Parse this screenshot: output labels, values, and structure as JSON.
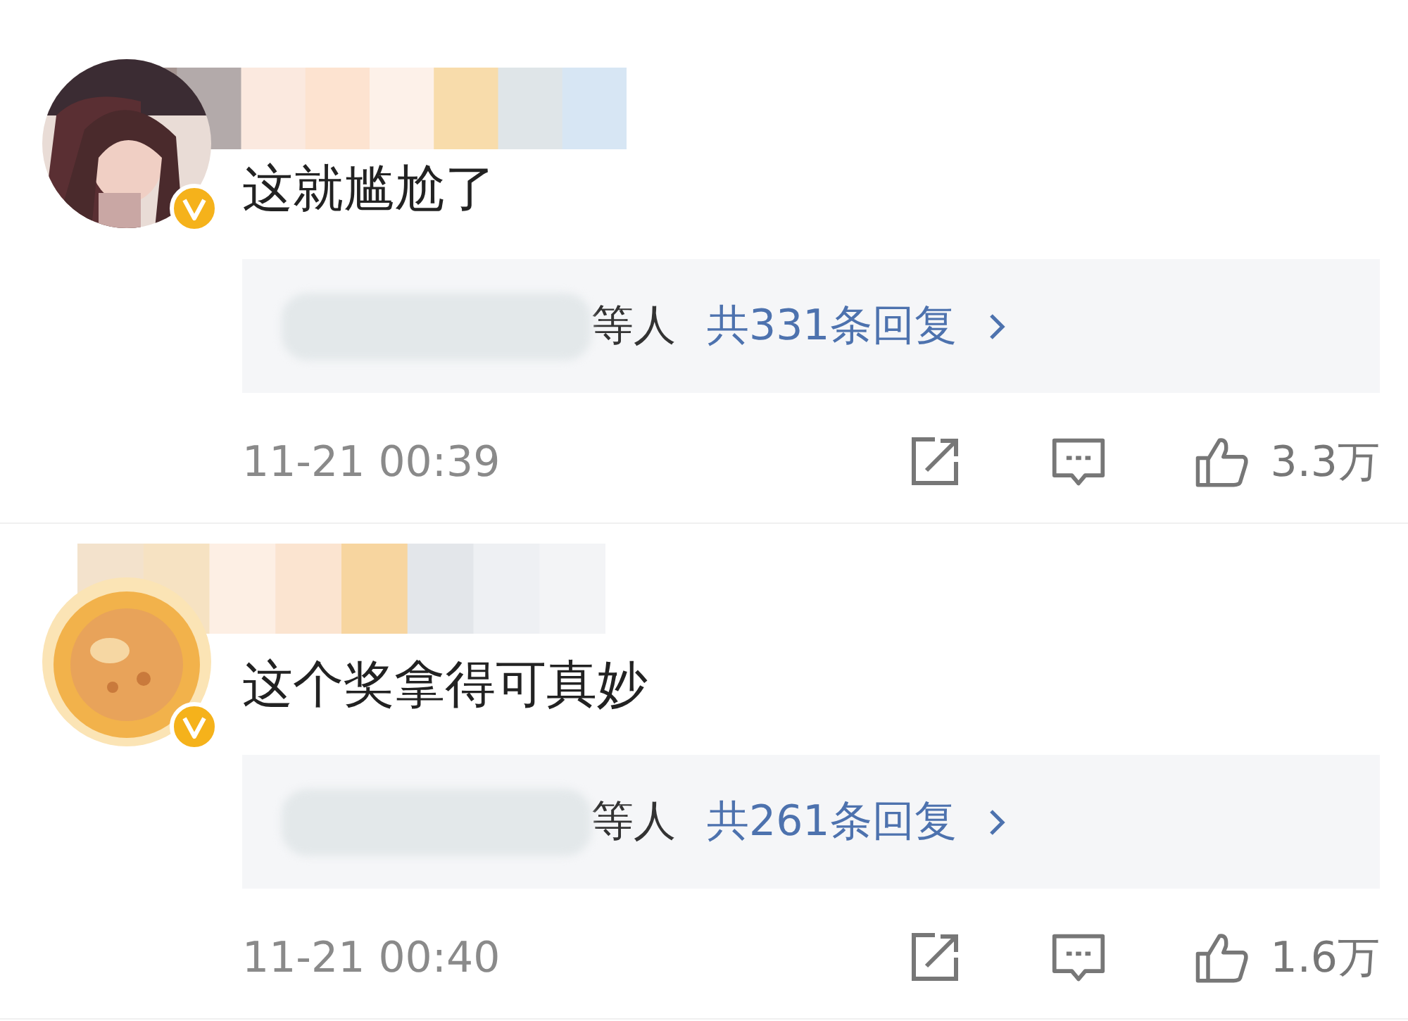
{
  "comments": [
    {
      "verified": true,
      "text": "这就尴尬了",
      "reply_suffix": "等人",
      "reply_count": "共331条回复",
      "time": "11-21 00:39",
      "likes": "3.3万"
    },
    {
      "avatar": {
        "kind": "illustration"
      },
      "verified": true,
      "text": "这个奖拿得可真妙",
      "reply_suffix": "等人",
      "reply_count": "共261条回复",
      "time": "11-21 00:40",
      "likes": "1.6万"
    }
  ]
}
